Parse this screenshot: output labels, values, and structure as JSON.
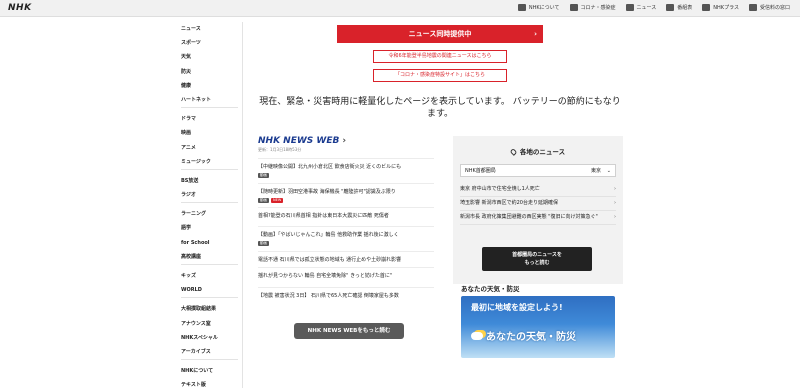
{
  "header": {
    "logo": "NHK",
    "nav": [
      {
        "label": "NHKについて",
        "icon": "info-icon"
      },
      {
        "label": "コロナ・感染症",
        "icon": "virus-icon"
      },
      {
        "label": "ニュース",
        "icon": "news-icon"
      },
      {
        "label": "番組表",
        "icon": "schedule-icon"
      },
      {
        "label": "NHKプラス",
        "icon": "plus-icon"
      },
      {
        "label": "受信料の窓口",
        "icon": "fee-icon"
      }
    ]
  },
  "sidebar": {
    "groups": [
      [
        "ニュース",
        "スポーツ",
        "天気",
        "防災",
        "健康",
        "ハートネット"
      ],
      [
        "ドラマ",
        "映画",
        "アニメ",
        "ミュージック"
      ],
      [
        "BS放送",
        "ラジオ"
      ],
      [
        "ラーニング",
        "語学",
        "for School",
        "高校講座"
      ],
      [
        "キッズ",
        "WORLD"
      ],
      [
        "大相撲取組結果",
        "アナウンス室",
        "NHKスペシャル",
        "アーカイブス"
      ],
      [
        "NHKについて",
        "テキスト版"
      ]
    ]
  },
  "banners": {
    "main": "ニュース同時提供中",
    "sub1": "令和6年能登半島地震の関連ニュースはこちら",
    "sub2": "「コロナ・感染症特設サイト」はこちら"
  },
  "notice": "現在、緊急・災害時用に軽量化したページを表示しています。 バッテリーの節約にもなります。",
  "newsweb": {
    "title": "NHK NEWS WEB",
    "updated": "更新：1月3日18時53分",
    "items": [
      {
        "text": "【中継映像公開】北九州小倉北区 飲食店街火災 近くのビルにも",
        "tags": [
          {
            "label": "動画",
            "red": false
          }
        ]
      },
      {
        "text": "【随時更新】羽田空港事故 海保機長 \"離陸許可\"認識及ぶ限り",
        "tags": [
          {
            "label": "動画",
            "red": false
          },
          {
            "label": "NEW",
            "red": true
          }
        ]
      },
      {
        "text": "首相?能登の石川県首相 指針は東日本大震災に匹敵 死傷者",
        "tags": []
      },
      {
        "text": "【動画】「やばいじゃんこれ」輪島 他救助作業 揺れ後に激しく",
        "tags": [
          {
            "label": "動画",
            "red": false
          }
        ]
      },
      {
        "text": "電話不通 石川県では孤立状態の地域も 通行止めや土砂崩れ影響",
        "tags": []
      },
      {
        "text": "揺れが見つからない 輪島 自宅全壊免除\" きっと妨げた首に\"",
        "tags": []
      },
      {
        "text": "【地震 被害状況 3日】 石川県で65人死亡確認 倒壊家屋も多数",
        "tags": []
      }
    ],
    "more_label": "NHK NEWS WEBをもっと読む"
  },
  "region": {
    "title": "各地のニュース",
    "select_label": "NHK首都圏局",
    "select_pref": "東京",
    "items": [
      "東京 府中山市で住宅全焼し1人死亡",
      "埼玉影響 新潟市西区で約20台走り延期確保",
      "新潟市長 政府化策集団避難の西区実態 \"復旧に向け対策急ぐ\""
    ],
    "more_label_1": "首都圏局のニュースを",
    "more_label_2": "もっと読む"
  },
  "weather": {
    "title": "あなたの天気・防災",
    "card_line1": "最初に地域を設定しよう!",
    "card_line2": "あなたの天気・防災"
  },
  "colors": {
    "brand_red": "#d9222a",
    "newsweb_blue": "#1a3a8f",
    "weather_blue": "#2f6fc2"
  }
}
